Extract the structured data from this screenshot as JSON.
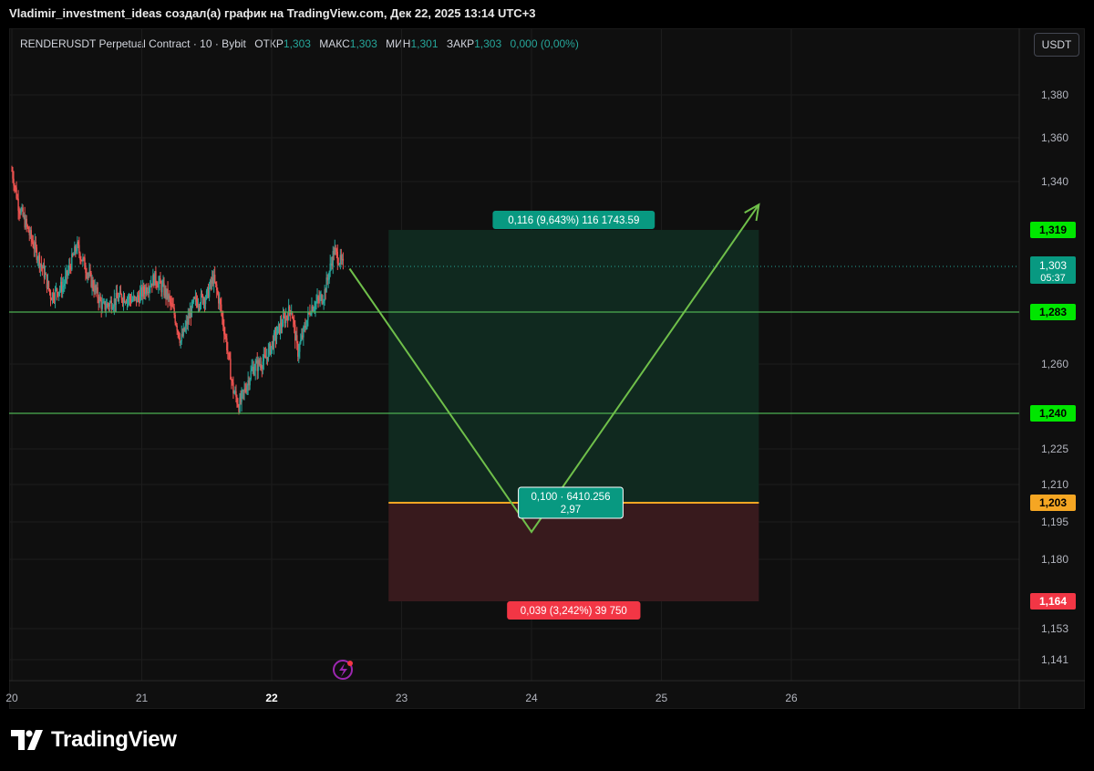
{
  "caption": "Vladimir_investment_ideas создал(а) график на TradingView.com, Дек 22, 2025 13:14 UTC+3",
  "legend": {
    "symbol": "RENDERUSDT Perpetual Contract · 10 · Bybit",
    "open_label": "ОТКР",
    "open": "1,303",
    "high_label": "МАКС",
    "high": "1,303",
    "low_label": "МИН",
    "low": "1,301",
    "close_label": "ЗАКР",
    "close": "1,303",
    "change": "0,000 (0,00%)"
  },
  "currency_button": "USDT",
  "brand": "TradingView",
  "colors": {
    "up": "#26a69a",
    "down": "#ef5350",
    "level": "#4caf50",
    "entry": "#f5a623",
    "arrow": "#6fbf4a",
    "profit_zone": "#10291f",
    "loss_zone": "#381a1d",
    "stop_tag": "#f23645",
    "target_tag": "#089981"
  },
  "chart_data": {
    "type": "candlestick",
    "x_ticks": [
      "20",
      "21",
      "22",
      "23",
      "24",
      "25",
      "26"
    ],
    "x_bold": "22",
    "y_ticks": [
      "1,380",
      "1,360",
      "1,340",
      "1,260",
      "1,225",
      "1,210",
      "1,195",
      "1,180",
      "1,153",
      "1,141"
    ],
    "y_range": [
      1.135,
      1.395
    ],
    "approx_series": {
      "description": "price path for RENDERUSDT 10m candles, Dec 20–22",
      "x_start": 20.0,
      "x_end": 22.55,
      "anchors": [
        [
          20.0,
          1.345
        ],
        [
          20.05,
          1.33
        ],
        [
          20.15,
          1.315
        ],
        [
          20.25,
          1.3
        ],
        [
          20.3,
          1.29
        ],
        [
          20.4,
          1.295
        ],
        [
          20.5,
          1.312
        ],
        [
          20.6,
          1.298
        ],
        [
          20.7,
          1.285
        ],
        [
          20.85,
          1.29
        ],
        [
          20.95,
          1.288
        ],
        [
          21.1,
          1.298
        ],
        [
          21.2,
          1.29
        ],
        [
          21.25,
          1.282
        ],
        [
          21.3,
          1.27
        ],
        [
          21.4,
          1.287
        ],
        [
          21.5,
          1.29
        ],
        [
          21.55,
          1.298
        ],
        [
          21.6,
          1.287
        ],
        [
          21.65,
          1.27
        ],
        [
          21.7,
          1.25
        ],
        [
          21.75,
          1.243
        ],
        [
          21.85,
          1.258
        ],
        [
          21.95,
          1.262
        ],
        [
          22.05,
          1.275
        ],
        [
          22.15,
          1.285
        ],
        [
          22.2,
          1.265
        ],
        [
          22.3,
          1.285
        ],
        [
          22.4,
          1.29
        ],
        [
          22.48,
          1.31
        ],
        [
          22.55,
          1.303
        ]
      ]
    },
    "levels": [
      {
        "name": "resistance",
        "price": "1,283"
      },
      {
        "name": "support",
        "price": "1,240"
      }
    ],
    "position": {
      "type": "long",
      "entry": "1,203",
      "target": "1,319",
      "stop": "1,164",
      "x_range": [
        22.9,
        25.75
      ],
      "target_label": "0,116 (9,643%) 116 1743.59",
      "stop_label": "0,039 (3,242%) 39 750",
      "entry_label_line1": "0,100 · 6410.256",
      "entry_label_line2": "2,97"
    },
    "forecast_path": [
      [
        22.6,
        1.302
      ],
      [
        24.0,
        1.191
      ],
      [
        25.75,
        1.33
      ]
    ],
    "current_price": "1,303",
    "countdown": "05:37"
  }
}
